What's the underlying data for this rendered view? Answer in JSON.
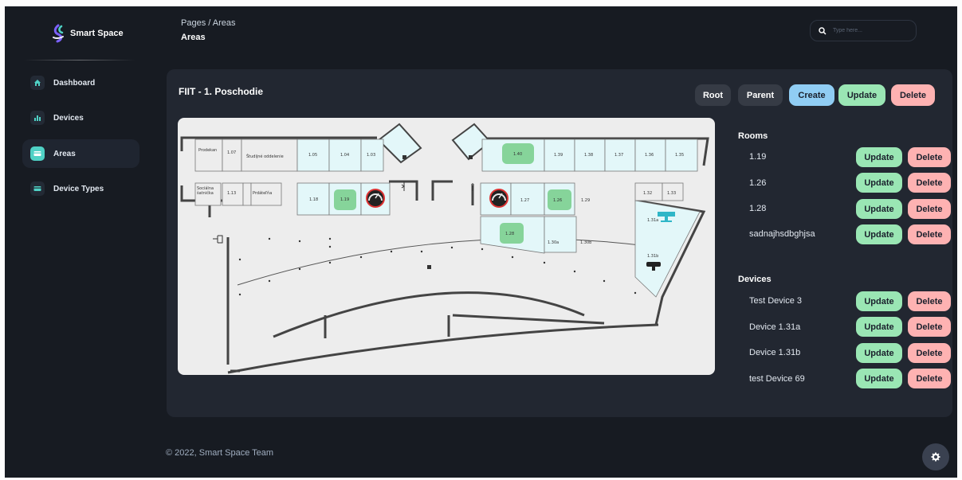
{
  "brand": {
    "name": "Smart Space"
  },
  "sidebar": {
    "items": [
      {
        "label": "Dashboard",
        "icon": "home-icon",
        "active": false
      },
      {
        "label": "Devices",
        "icon": "bar-chart-icon",
        "active": false
      },
      {
        "label": "Areas",
        "icon": "card-icon",
        "active": true
      },
      {
        "label": "Device Types",
        "icon": "card-icon",
        "active": false
      }
    ]
  },
  "header": {
    "breadcrumb": "Pages / Areas",
    "title": "Areas",
    "search": {
      "placeholder": "Type here...",
      "value": ""
    }
  },
  "area": {
    "title": "FIIT - 1. Poschodie",
    "actions": {
      "root": "Root",
      "parent": "Parent",
      "create": "Create",
      "update": "Update",
      "delete": "Delete"
    }
  },
  "floorplan": {
    "rooms_top": [
      "Prodekan",
      "1.07",
      "Študijné oddelenie",
      "1.05",
      "1.04",
      "1.03",
      "1.40",
      "1.39",
      "1.38",
      "1.37",
      "1.36",
      "1.35"
    ],
    "rooms_mid": [
      "Sociálna šatnička",
      "1.13",
      "Prdáteľňa",
      "1.18",
      "1.19",
      "1.27",
      "1.26",
      "1.29",
      "1.32",
      "1.33"
    ],
    "rooms_low": [
      "1.28",
      "1.30a",
      "1.30b",
      "1.31a",
      "1.31b"
    ]
  },
  "rooms": {
    "title": "Rooms",
    "items": [
      {
        "name": "1.19",
        "update": "Update",
        "delete": "Delete"
      },
      {
        "name": "1.26",
        "update": "Update",
        "delete": "Delete"
      },
      {
        "name": "1.28",
        "update": "Update",
        "delete": "Delete"
      },
      {
        "name": "sadnajhsdbghjsa",
        "update": "Update",
        "delete": "Delete"
      }
    ]
  },
  "devices": {
    "title": "Devices",
    "items": [
      {
        "name": "Test Device 3",
        "update": "Update",
        "delete": "Delete"
      },
      {
        "name": "Device 1.31a",
        "update": "Update",
        "delete": "Delete"
      },
      {
        "name": "Device 1.31b",
        "update": "Update",
        "delete": "Delete"
      },
      {
        "name": "test Device 69",
        "update": "Update",
        "delete": "Delete"
      }
    ]
  },
  "footer": {
    "text": "© 2022, Smart Space Team"
  },
  "colors": {
    "accent": "#4fd1c5",
    "create": "#90cdf4",
    "update": "#9ae6b4",
    "delete": "#feb2b2",
    "highlight_room": "#86d49a",
    "room_fill": "#e3f7f9"
  }
}
